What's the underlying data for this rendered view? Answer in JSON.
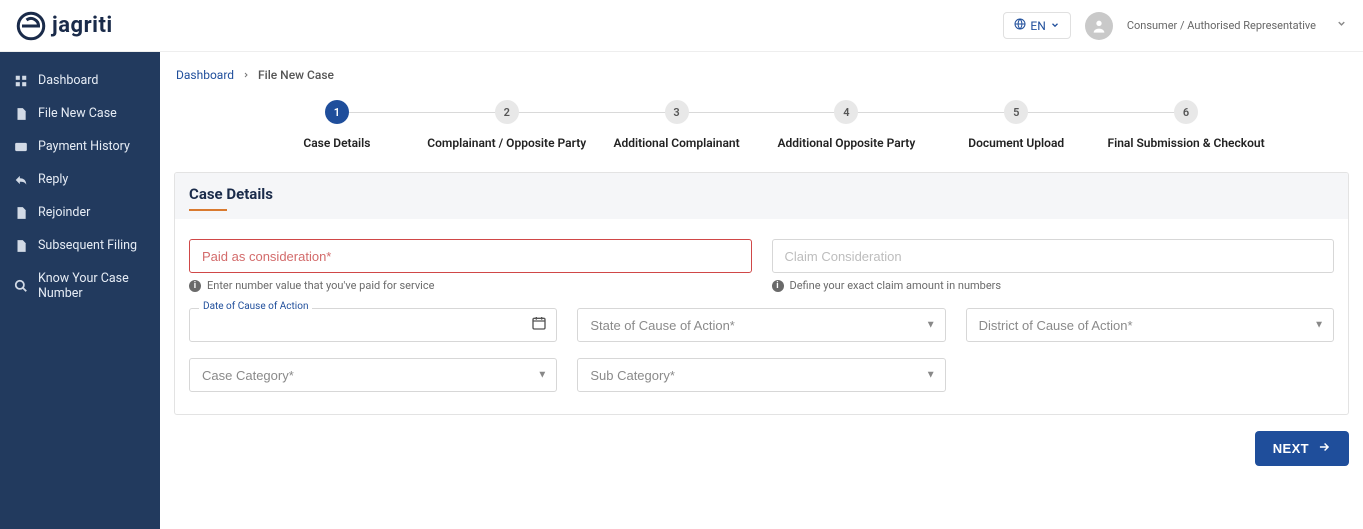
{
  "brand": {
    "name": "jagriti"
  },
  "header": {
    "lang": "EN",
    "role": "Consumer / Authorised Representative"
  },
  "sidebar": {
    "items": [
      {
        "label": "Dashboard"
      },
      {
        "label": "File New Case"
      },
      {
        "label": "Payment History"
      },
      {
        "label": "Reply"
      },
      {
        "label": "Rejoinder"
      },
      {
        "label": "Subsequent Filing"
      },
      {
        "label": "Know Your Case Number"
      }
    ]
  },
  "breadcrumb": {
    "root": "Dashboard",
    "current": "File New Case"
  },
  "stepper": {
    "steps": [
      {
        "num": "1",
        "label": "Case Details",
        "active": true
      },
      {
        "num": "2",
        "label": "Complainant / Opposite Party"
      },
      {
        "num": "3",
        "label": "Additional Complainant"
      },
      {
        "num": "4",
        "label": "Additional Opposite Party"
      },
      {
        "num": "5",
        "label": "Document Upload"
      },
      {
        "num": "6",
        "label": "Final Submission & Checkout"
      }
    ]
  },
  "card": {
    "title": "Case Details"
  },
  "form": {
    "paid_placeholder": "Paid as consideration*",
    "paid_helper": "Enter number value that you've paid for service",
    "claim_placeholder": "Claim Consideration",
    "claim_helper": "Define your exact claim amount in numbers",
    "date_label": "Date of Cause of Action",
    "state_placeholder": "State of Cause of Action*",
    "district_placeholder": "District of Cause of Action*",
    "category_placeholder": "Case Category*",
    "subcategory_placeholder": "Sub Category*"
  },
  "actions": {
    "next": "NEXT"
  }
}
